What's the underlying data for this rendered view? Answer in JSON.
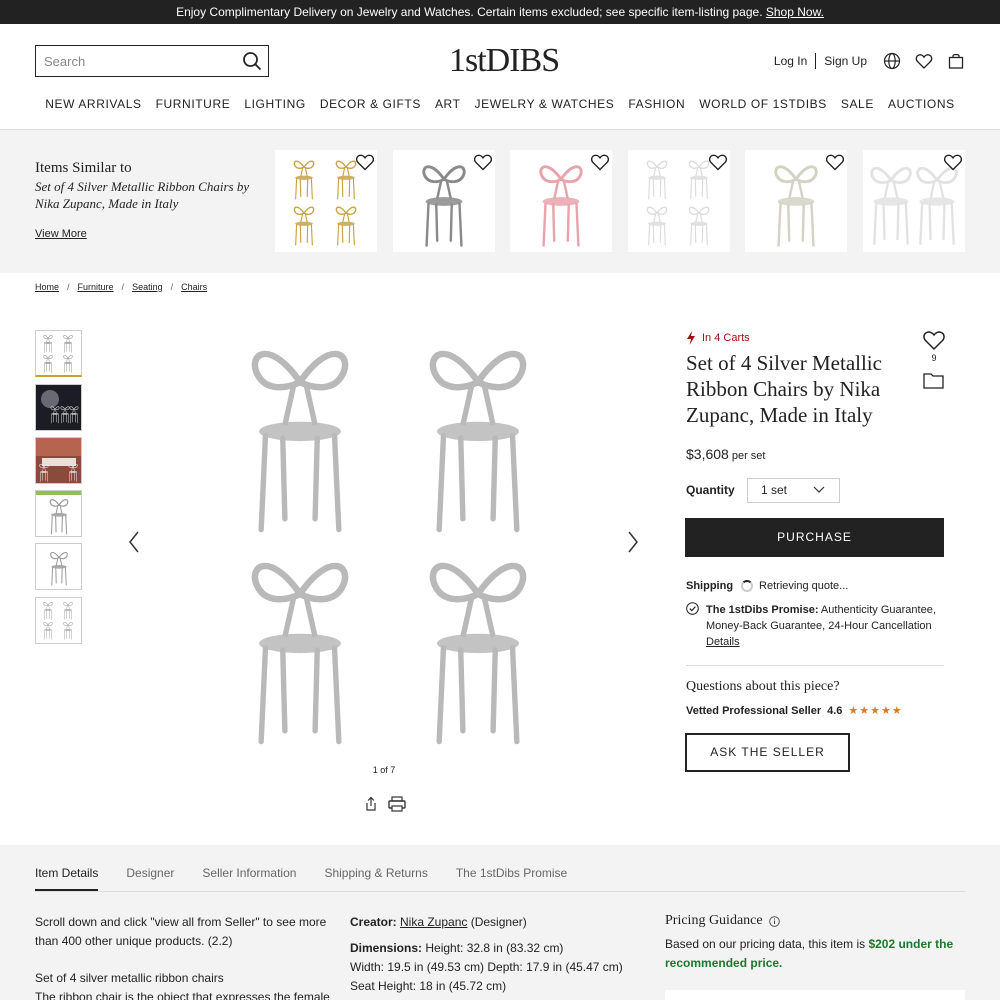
{
  "promo": {
    "text": "Enjoy Complimentary Delivery on Jewelry and Watches. Certain items excluded; see specific item-listing page. ",
    "link": "Shop Now."
  },
  "header": {
    "search_placeholder": "Search",
    "logo": "1stDIBS",
    "login": "Log In",
    "signup": "Sign Up"
  },
  "nav": [
    "NEW ARRIVALS",
    "FURNITURE",
    "LIGHTING",
    "DECOR & GIFTS",
    "ART",
    "JEWELRY & WATCHES",
    "FASHION",
    "WORLD OF 1STDIBS",
    "SALE",
    "AUCTIONS"
  ],
  "similar": {
    "title": "Items Similar to",
    "subtitle": "Set of 4 Silver Metallic Ribbon Chairs by Nika Zupanc, Made in Italy",
    "view_more": "View More",
    "cards": [
      {
        "variant": "gold-four"
      },
      {
        "variant": "silver-single"
      },
      {
        "variant": "pink-single"
      },
      {
        "variant": "white-four"
      },
      {
        "variant": "cream-single"
      },
      {
        "variant": "white-pair"
      }
    ]
  },
  "breadcrumbs": [
    "Home",
    "Furniture",
    "Seating",
    "Chairs"
  ],
  "gallery": {
    "counter": "1 of 7",
    "thumbnails": 6
  },
  "product": {
    "carts": "In 4 Carts",
    "favorites_count": "9",
    "title": "Set of 4 Silver Metallic Ribbon Chairs by Nika Zupanc, Made in Italy",
    "price": "$3,608",
    "price_unit": "per set",
    "quantity_label": "Quantity",
    "quantity_value": "1 set",
    "purchase": "PURCHASE",
    "shipping_label": "Shipping",
    "shipping_status": "Retrieving quote...",
    "promise_title": "The 1stDibs Promise:",
    "promise_text": " Authenticity Guarantee, Money-Back Guarantee, 24-Hour Cancellation",
    "promise_link": "Details",
    "questions": "Questions about this piece?",
    "seller_label": "Vetted Professional Seller",
    "seller_rating": "4.6",
    "stars": "★★★★★",
    "ask": "ASK THE SELLER"
  },
  "details": {
    "tabs": [
      "Item Details",
      "Designer",
      "Seller Information",
      "Shipping & Returns",
      "The 1stDibs Promise"
    ],
    "desc1": "Scroll down and click \"view all from Seller\" to see more than 400 other unique products. (2.2)",
    "desc2": "Set of 4 silver metallic ribbon chairs",
    "desc3": "The ribbon chair is the object that expresses the female",
    "creator_label": "Creator: ",
    "creator_name": "Nika Zupanc",
    "creator_role": " (Designer)",
    "dimensions_label": "Dimensions: ",
    "dim_height": "Height: 32.8 in (83.32 cm)",
    "dim_line2": "Width: 19.5 in (49.53 cm) Depth: 17.9 in (45.47 cm)",
    "dim_line3": "Seat Height: 18 in (45.72 cm)",
    "pricing_title": "Pricing Guidance",
    "pricing_text": "Based on our pricing data, this item is ",
    "pricing_highlight": "$202 under the recommended price."
  },
  "colors": {
    "dark": "#222222",
    "alert": "#a01010",
    "star": "#e07b1a",
    "green": "#1a7a2c",
    "panel": "#f3f3f3"
  }
}
